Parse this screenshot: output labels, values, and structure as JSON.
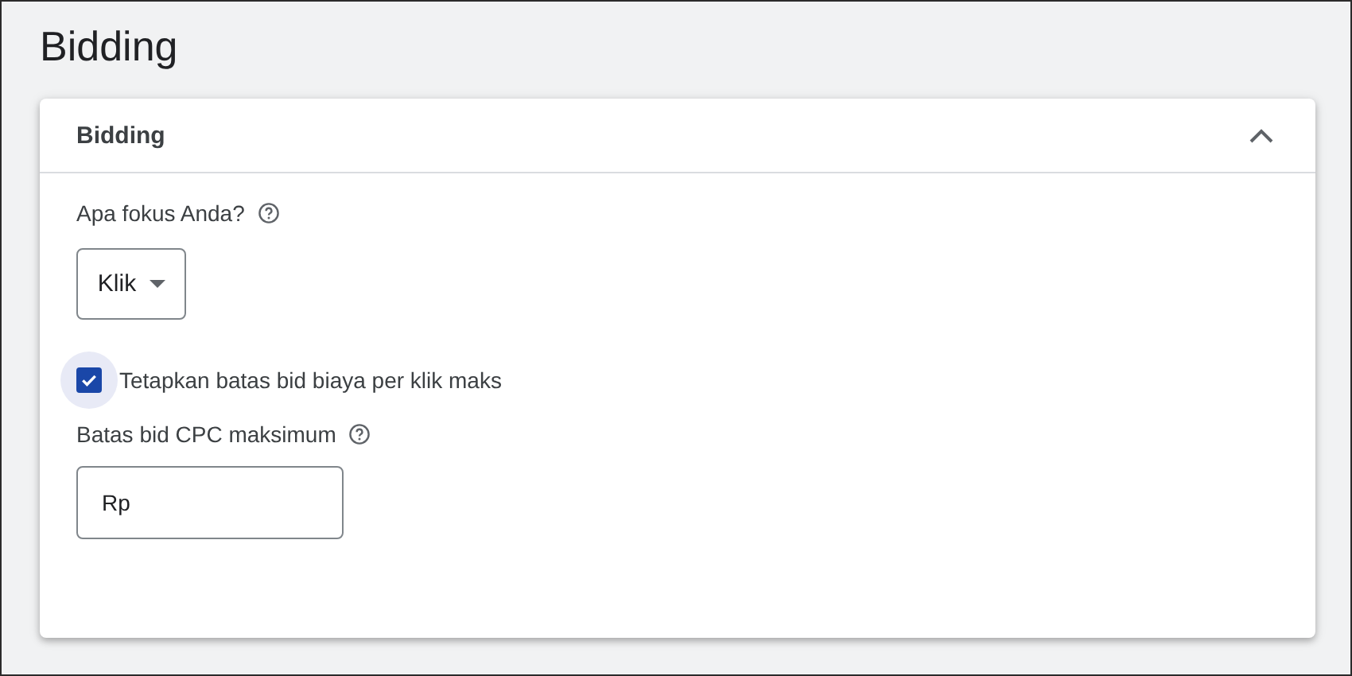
{
  "page": {
    "title": "Bidding"
  },
  "card": {
    "title": "Bidding",
    "expanded": true,
    "focus": {
      "label": "Apa fokus Anda?",
      "value": "Klik"
    },
    "limit_checkbox": {
      "label": "Tetapkan batas bid biaya per klik maks",
      "checked": true
    },
    "max_cpc": {
      "label": "Batas bid CPC maksimum",
      "placeholder": "Rp"
    }
  }
}
